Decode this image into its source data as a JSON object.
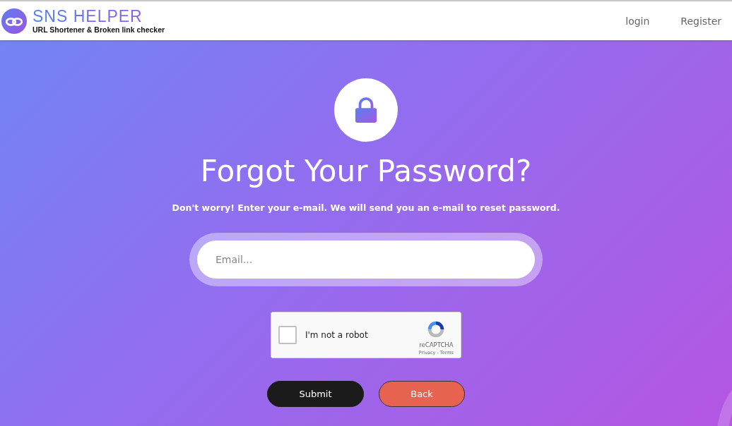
{
  "header": {
    "logo_title": "SNS HELPER",
    "logo_subtitle": "URL Shortener & Broken link checker",
    "nav": [
      {
        "label": "login"
      },
      {
        "label": "Register"
      }
    ]
  },
  "main": {
    "title": "Forgot Your Password?",
    "subtitle": "Don't worry! Enter your e-mail. We will send you an e-mail to reset password.",
    "email": {
      "placeholder": "Email..."
    },
    "captcha": {
      "label": "I'm not a robot",
      "checked": false,
      "brand": "reCAPTCHA",
      "links": "Privacy - Terms"
    },
    "buttons": [
      {
        "label": "Submit",
        "kind": "primary"
      },
      {
        "label": "Back",
        "kind": "secondary"
      }
    ]
  }
}
